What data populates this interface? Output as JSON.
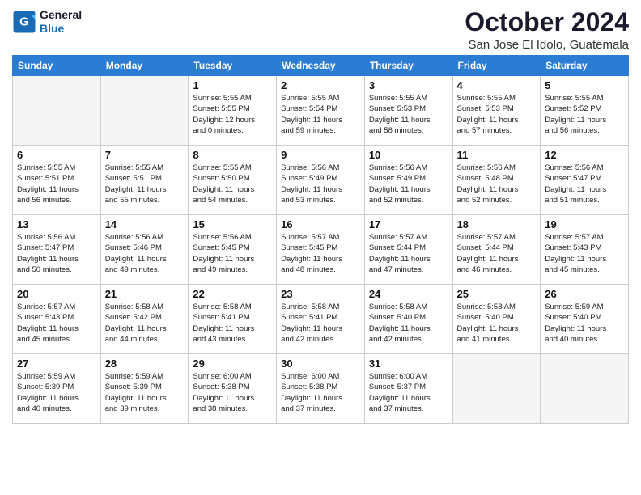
{
  "logo": {
    "line1": "General",
    "line2": "Blue"
  },
  "title": "October 2024",
  "location": "San Jose El Idolo, Guatemala",
  "weekdays": [
    "Sunday",
    "Monday",
    "Tuesday",
    "Wednesday",
    "Thursday",
    "Friday",
    "Saturday"
  ],
  "weeks": [
    [
      {
        "day": "",
        "info": ""
      },
      {
        "day": "",
        "info": ""
      },
      {
        "day": "1",
        "info": "Sunrise: 5:55 AM\nSunset: 5:55 PM\nDaylight: 12 hours\nand 0 minutes."
      },
      {
        "day": "2",
        "info": "Sunrise: 5:55 AM\nSunset: 5:54 PM\nDaylight: 11 hours\nand 59 minutes."
      },
      {
        "day": "3",
        "info": "Sunrise: 5:55 AM\nSunset: 5:53 PM\nDaylight: 11 hours\nand 58 minutes."
      },
      {
        "day": "4",
        "info": "Sunrise: 5:55 AM\nSunset: 5:53 PM\nDaylight: 11 hours\nand 57 minutes."
      },
      {
        "day": "5",
        "info": "Sunrise: 5:55 AM\nSunset: 5:52 PM\nDaylight: 11 hours\nand 56 minutes."
      }
    ],
    [
      {
        "day": "6",
        "info": "Sunrise: 5:55 AM\nSunset: 5:51 PM\nDaylight: 11 hours\nand 56 minutes."
      },
      {
        "day": "7",
        "info": "Sunrise: 5:55 AM\nSunset: 5:51 PM\nDaylight: 11 hours\nand 55 minutes."
      },
      {
        "day": "8",
        "info": "Sunrise: 5:55 AM\nSunset: 5:50 PM\nDaylight: 11 hours\nand 54 minutes."
      },
      {
        "day": "9",
        "info": "Sunrise: 5:56 AM\nSunset: 5:49 PM\nDaylight: 11 hours\nand 53 minutes."
      },
      {
        "day": "10",
        "info": "Sunrise: 5:56 AM\nSunset: 5:49 PM\nDaylight: 11 hours\nand 52 minutes."
      },
      {
        "day": "11",
        "info": "Sunrise: 5:56 AM\nSunset: 5:48 PM\nDaylight: 11 hours\nand 52 minutes."
      },
      {
        "day": "12",
        "info": "Sunrise: 5:56 AM\nSunset: 5:47 PM\nDaylight: 11 hours\nand 51 minutes."
      }
    ],
    [
      {
        "day": "13",
        "info": "Sunrise: 5:56 AM\nSunset: 5:47 PM\nDaylight: 11 hours\nand 50 minutes."
      },
      {
        "day": "14",
        "info": "Sunrise: 5:56 AM\nSunset: 5:46 PM\nDaylight: 11 hours\nand 49 minutes."
      },
      {
        "day": "15",
        "info": "Sunrise: 5:56 AM\nSunset: 5:45 PM\nDaylight: 11 hours\nand 49 minutes."
      },
      {
        "day": "16",
        "info": "Sunrise: 5:57 AM\nSunset: 5:45 PM\nDaylight: 11 hours\nand 48 minutes."
      },
      {
        "day": "17",
        "info": "Sunrise: 5:57 AM\nSunset: 5:44 PM\nDaylight: 11 hours\nand 47 minutes."
      },
      {
        "day": "18",
        "info": "Sunrise: 5:57 AM\nSunset: 5:44 PM\nDaylight: 11 hours\nand 46 minutes."
      },
      {
        "day": "19",
        "info": "Sunrise: 5:57 AM\nSunset: 5:43 PM\nDaylight: 11 hours\nand 45 minutes."
      }
    ],
    [
      {
        "day": "20",
        "info": "Sunrise: 5:57 AM\nSunset: 5:43 PM\nDaylight: 11 hours\nand 45 minutes."
      },
      {
        "day": "21",
        "info": "Sunrise: 5:58 AM\nSunset: 5:42 PM\nDaylight: 11 hours\nand 44 minutes."
      },
      {
        "day": "22",
        "info": "Sunrise: 5:58 AM\nSunset: 5:41 PM\nDaylight: 11 hours\nand 43 minutes."
      },
      {
        "day": "23",
        "info": "Sunrise: 5:58 AM\nSunset: 5:41 PM\nDaylight: 11 hours\nand 42 minutes."
      },
      {
        "day": "24",
        "info": "Sunrise: 5:58 AM\nSunset: 5:40 PM\nDaylight: 11 hours\nand 42 minutes."
      },
      {
        "day": "25",
        "info": "Sunrise: 5:58 AM\nSunset: 5:40 PM\nDaylight: 11 hours\nand 41 minutes."
      },
      {
        "day": "26",
        "info": "Sunrise: 5:59 AM\nSunset: 5:40 PM\nDaylight: 11 hours\nand 40 minutes."
      }
    ],
    [
      {
        "day": "27",
        "info": "Sunrise: 5:59 AM\nSunset: 5:39 PM\nDaylight: 11 hours\nand 40 minutes."
      },
      {
        "day": "28",
        "info": "Sunrise: 5:59 AM\nSunset: 5:39 PM\nDaylight: 11 hours\nand 39 minutes."
      },
      {
        "day": "29",
        "info": "Sunrise: 6:00 AM\nSunset: 5:38 PM\nDaylight: 11 hours\nand 38 minutes."
      },
      {
        "day": "30",
        "info": "Sunrise: 6:00 AM\nSunset: 5:38 PM\nDaylight: 11 hours\nand 37 minutes."
      },
      {
        "day": "31",
        "info": "Sunrise: 6:00 AM\nSunset: 5:37 PM\nDaylight: 11 hours\nand 37 minutes."
      },
      {
        "day": "",
        "info": ""
      },
      {
        "day": "",
        "info": ""
      }
    ]
  ]
}
